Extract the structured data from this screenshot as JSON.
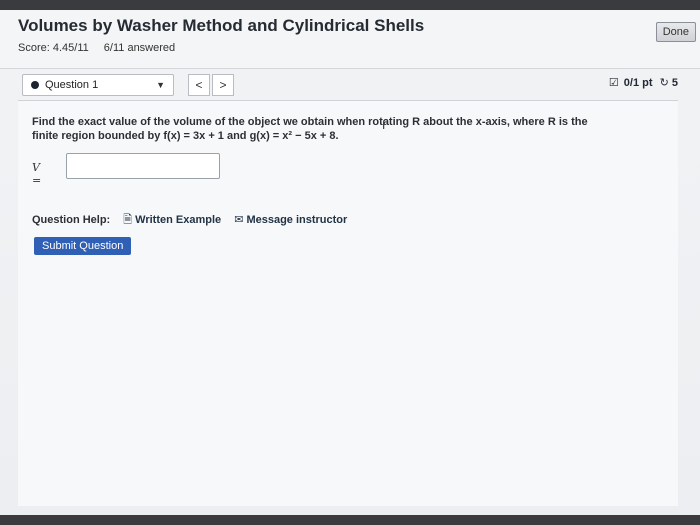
{
  "header": {
    "title": "Volumes by Washer Method and Cylindrical Shells",
    "score": "Score: 4.45/11",
    "answered": "6/11 answered",
    "done_label": "Done"
  },
  "question_nav": {
    "current": "Question 1",
    "prev_label": "<",
    "next_label": ">",
    "points": "0/1 pt",
    "retries": "5"
  },
  "question": {
    "text_line1": "Find the exact value of the volume of the object we obtain when rotating R about the x-axis, where R is the",
    "text_line2": "finite region bounded by f(x) = 3x + 1 and g(x) = x² − 5x + 8."
  },
  "answer": {
    "label": "V =",
    "value": "",
    "placeholder": ""
  },
  "help": {
    "label": "Question Help:",
    "written_example": "Written Example",
    "message_instructor": "Message instructor"
  },
  "submit_label": "Submit Question",
  "colors": {
    "submit": "#2f60b6",
    "title": "#262b33"
  }
}
